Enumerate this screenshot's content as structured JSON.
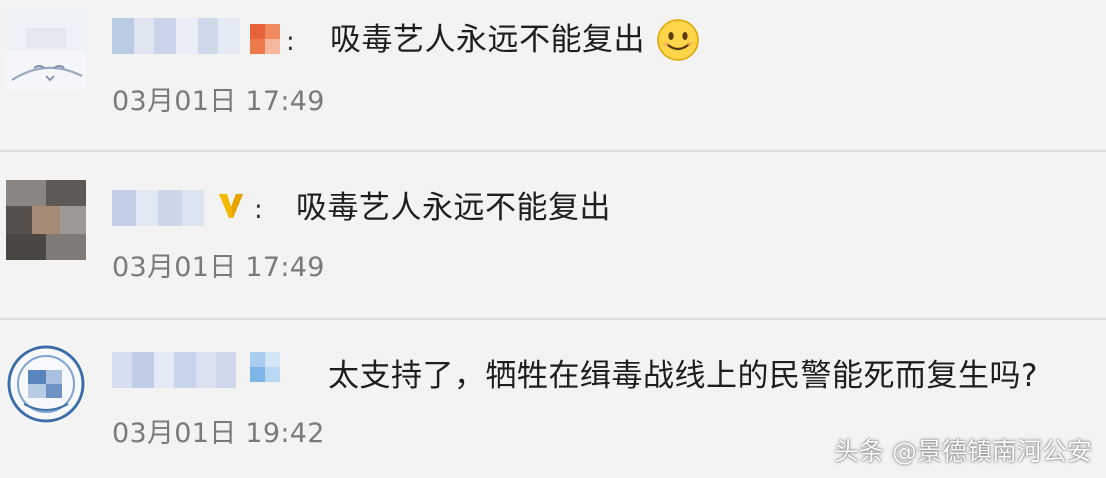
{
  "comments": [
    {
      "text": "吸毒艺人永远不能复出",
      "separator": ":",
      "timestamp": "03月01日 17:49",
      "badge": "orange-badge-icon",
      "has_emoji": true,
      "emoji": "smiley-emoji-icon"
    },
    {
      "text": "吸毒艺人永远不能复出",
      "separator": ":",
      "timestamp": "03月01日 17:49",
      "badge": "verified-v-icon"
    },
    {
      "text": "太支持了，牺牲在缉毒战线上的民警能死而复生吗?",
      "separator": "",
      "timestamp": "03月01日 19:42",
      "badge": "blue-badge-icon"
    }
  ],
  "watermark": "头条 @景德镇南河公安",
  "colors": {
    "background": "#f3f3f3",
    "text": "#1e1e1e",
    "timestamp": "#7a7a7a",
    "divider": "#dcdcdc",
    "verified": "#f5b800",
    "emoji": "#ffd54a"
  }
}
